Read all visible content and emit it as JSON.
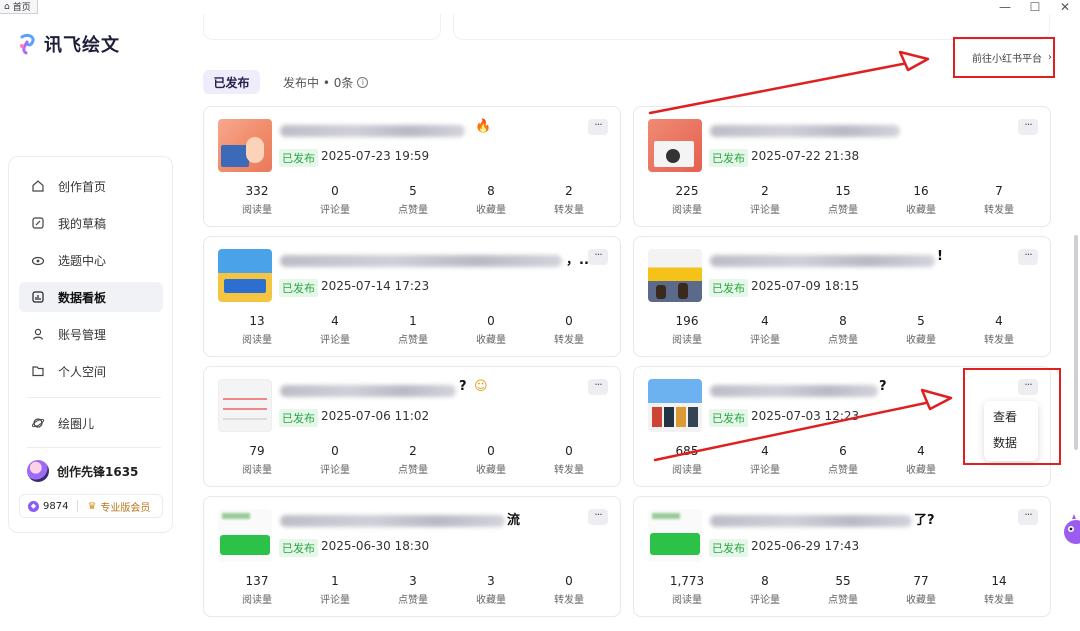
{
  "window": {
    "tab_label": "首页",
    "minimize": "—",
    "maximize": "☐",
    "close": "✕"
  },
  "app": {
    "name": "讯飞绘文"
  },
  "sidebar": {
    "items": [
      {
        "label": "创作首页",
        "icon": "home-icon"
      },
      {
        "label": "我的草稿",
        "icon": "edit-icon"
      },
      {
        "label": "选题中心",
        "icon": "eye-icon"
      },
      {
        "label": "数据看板",
        "icon": "chart-icon"
      },
      {
        "label": "账号管理",
        "icon": "user-icon"
      },
      {
        "label": "个人空间",
        "icon": "folder-icon"
      },
      {
        "label": "绘圈儿",
        "icon": "planet-icon"
      }
    ],
    "active_item": "数据看板",
    "user": {
      "name": "创作先锋1635",
      "points": "9874",
      "membership": "专业版会员"
    }
  },
  "tabs": {
    "published": "已发布",
    "publishing": "发布中 • 0条"
  },
  "platform_link": "前往小红书平台",
  "stat_labels": [
    "阅读量",
    "评论量",
    "点赞量",
    "收藏量",
    "转发量"
  ],
  "status_label": "已发布",
  "more_label": "···",
  "posts": [
    {
      "title_tail": "",
      "date": "2025-07-23 19:59",
      "stats": [
        "332",
        "0",
        "5",
        "8",
        "2"
      ]
    },
    {
      "title_tail": "",
      "date": "2025-07-22 21:38",
      "stats": [
        "225",
        "2",
        "15",
        "16",
        "7"
      ]
    },
    {
      "title_tail": "，...",
      "date": "2025-07-14 17:23",
      "stats": [
        "13",
        "4",
        "1",
        "0",
        "0"
      ]
    },
    {
      "title_tail": "!",
      "date": "2025-07-09 18:15",
      "stats": [
        "196",
        "4",
        "8",
        "5",
        "4"
      ]
    },
    {
      "title_tail": "?",
      "date": "2025-07-06 11:02",
      "stats": [
        "79",
        "0",
        "2",
        "0",
        "0"
      ]
    },
    {
      "title_tail": "?",
      "date": "2025-07-03 12:23",
      "stats": [
        "685",
        "4",
        "6",
        "4",
        ""
      ]
    },
    {
      "title_tail": "流",
      "date": "2025-06-30 18:30",
      "stats": [
        "137",
        "1",
        "3",
        "3",
        "0"
      ]
    },
    {
      "title_tail": "了?",
      "date": "2025-06-29 17:43",
      "stats": [
        "1,773",
        "8",
        "55",
        "77",
        "14"
      ]
    }
  ],
  "popup_menu": [
    "查看",
    "数据"
  ],
  "annotation_color": "#e02020",
  "accent_color": "#8a5cf5"
}
